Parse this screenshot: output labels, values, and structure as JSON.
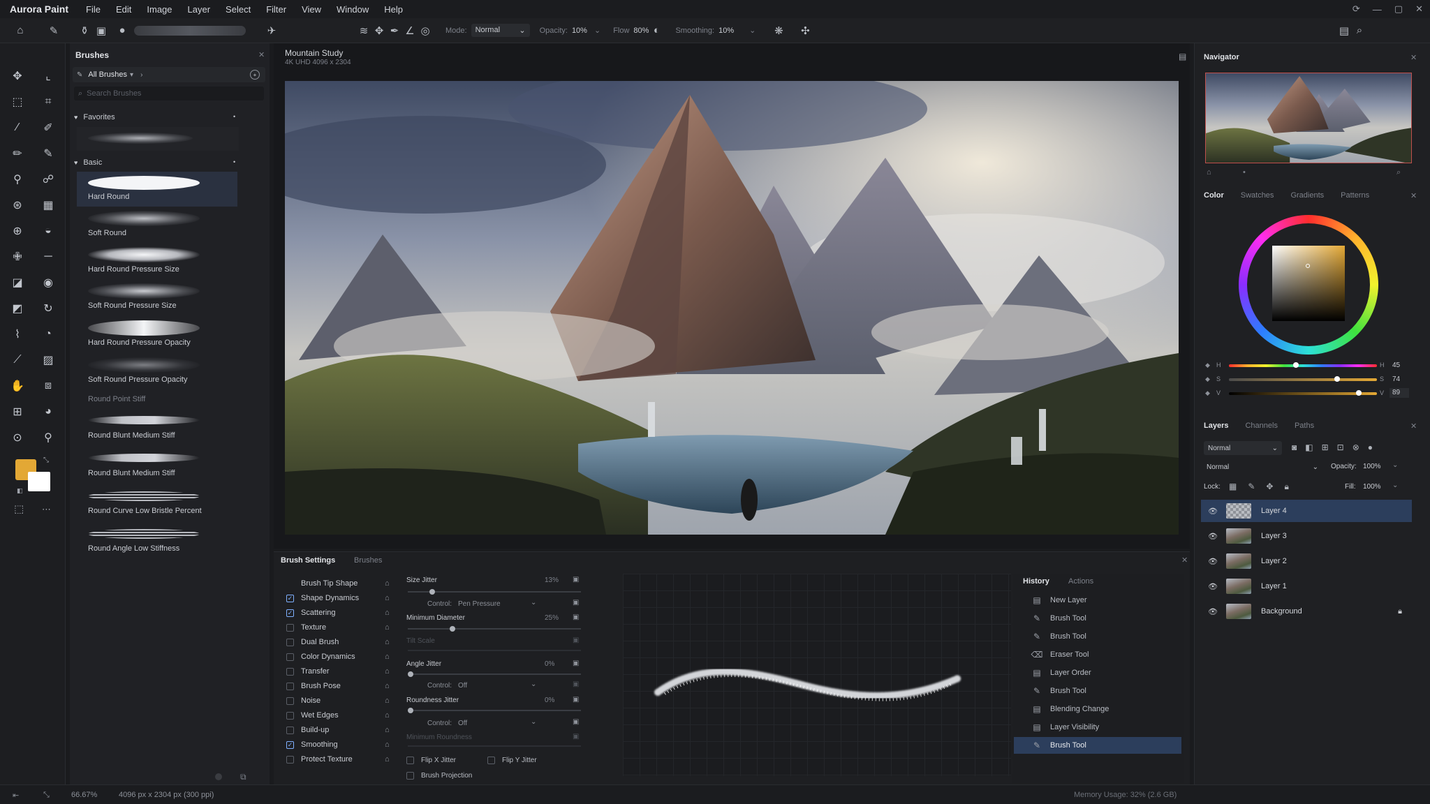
{
  "app": {
    "name": "Aurora Paint"
  },
  "menu": [
    "File",
    "Edit",
    "Image",
    "Layer",
    "Select",
    "Filter",
    "View",
    "Window",
    "Help"
  ],
  "options": {
    "mode_label": "Mode:",
    "mode_value": "Normal",
    "opacity_label": "Opacity:",
    "opacity_value": "10%",
    "flow_label": "Flow",
    "flow_value": "80%",
    "smoothing_label": "Smoothing:",
    "smoothing_value": "10%"
  },
  "colors": {
    "foreground": "#e3a835",
    "background": "#ffffff",
    "accent": "#2c3e5c"
  },
  "brushes_panel": {
    "title": "Brushes",
    "category": "All Brushes",
    "search_placeholder": "Search Brushes",
    "favorites_label": "Favorites",
    "basic_label": "Basic",
    "items": [
      "Hard Round",
      "Soft Round",
      "Hard Round Pressure Size",
      "Soft Round Pressure Size",
      "Hard Round Pressure Opacity",
      "Soft Round Pressure Opacity",
      "Round Point Stiff",
      "Round Blunt Medium Stiff",
      "Round Blunt Medium Stiff",
      "Round Curve Low Bristle Percent",
      "Round Angle Low Stiffness"
    ]
  },
  "document": {
    "title": "Mountain Study",
    "subtitle": "4K UHD 4096 x 2304"
  },
  "navigator": {
    "title": "Navigator"
  },
  "color_panel": {
    "tabs": [
      "Color",
      "Swatches",
      "Gradients",
      "Patterns"
    ],
    "h_label": "H",
    "s_label": "S",
    "v_label": "V",
    "h_value": "45",
    "s_value": "74",
    "v_value": "89",
    "h": 45,
    "s": 74,
    "v": 89
  },
  "layers_panel": {
    "tabs": [
      "Layers",
      "Channels",
      "Paths"
    ],
    "blend_mode": "Normal",
    "blend_mode_2": "Normal",
    "opacity_label": "Opacity:",
    "opacity_value": "100%",
    "lock_label": "Lock:",
    "fill_label": "Fill:",
    "fill_value": "100%",
    "layers": [
      "Layer 4",
      "Layer 3",
      "Layer 2",
      "Layer 1",
      "Background"
    ]
  },
  "brush_settings": {
    "tabs": [
      "Brush Settings",
      "Brushes"
    ],
    "options": [
      {
        "label": "Brush Tip Shape",
        "checked": null
      },
      {
        "label": "Shape Dynamics",
        "checked": true
      },
      {
        "label": "Scattering",
        "checked": true
      },
      {
        "label": "Texture",
        "checked": false
      },
      {
        "label": "Dual Brush",
        "checked": false
      },
      {
        "label": "Color Dynamics",
        "checked": false
      },
      {
        "label": "Transfer",
        "checked": false
      },
      {
        "label": "Brush Pose",
        "checked": false
      },
      {
        "label": "Noise",
        "checked": false
      },
      {
        "label": "Wet Edges",
        "checked": false
      },
      {
        "label": "Build-up",
        "checked": false
      },
      {
        "label": "Smoothing",
        "checked": true
      },
      {
        "label": "Protect Texture",
        "checked": false
      }
    ],
    "size_jitter_label": "Size Jitter",
    "size_jitter_value": "13%",
    "size_jitter": 13,
    "control_label": "Control:",
    "control_pen": "Pen Pressure",
    "min_diameter_label": "Minimum Diameter",
    "min_diameter_value": "25%",
    "min_diameter": 25,
    "tilt_scale_label": "Tilt Scale",
    "angle_jitter_label": "Angle Jitter",
    "angle_jitter_value": "0%",
    "angle_jitter": 0,
    "control_off": "Off",
    "roundness_jitter_label": "Roundness Jitter",
    "roundness_jitter_value": "0%",
    "roundness_jitter": 0,
    "min_roundness_label": "Minimum Roundness",
    "flip_x_label": "Flip X Jitter",
    "flip_y_label": "Flip Y Jitter",
    "projection_label": "Brush Projection"
  },
  "history": {
    "tabs": [
      "History",
      "Actions"
    ],
    "items": [
      "New Layer",
      "Brush Tool",
      "Brush Tool",
      "Eraser Tool",
      "Layer Order",
      "Brush Tool",
      "Blending Change",
      "Layer Visibility",
      "Brush Tool"
    ]
  },
  "status": {
    "zoom": "66.67%",
    "dimensions": "4096 px x 2304 px (300 ppi)",
    "memory": "Memory Usage: 32% (2.6 GB)"
  }
}
